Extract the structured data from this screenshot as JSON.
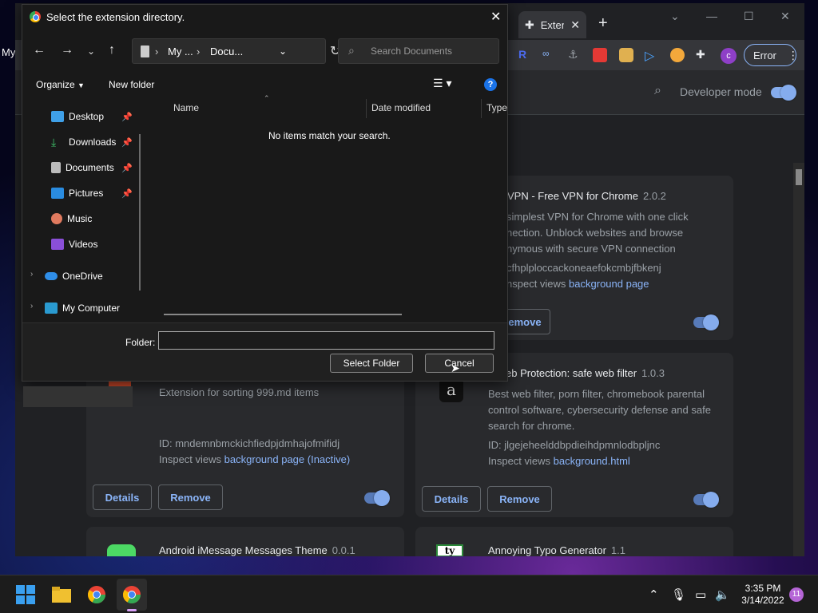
{
  "desktop": {
    "behind_text": "My"
  },
  "chrome": {
    "tab_title": "Extensions",
    "toolbar": {
      "error_label": "Error",
      "avatar_letter": "c"
    },
    "header": {
      "developer_mode_label": "Developer mode",
      "developer_mode_on": true
    },
    "cards": [
      {
        "name": "ckVPN - Free VPN for Chrome",
        "version": "2.0.2",
        "description": "simplest VPN for Chrome with one click nection. Unblock websites and browse nymous with secure VPN connection",
        "id_text": "cfhplploccackoneaefokcmbjfbkenj",
        "inspect_label": "nspect views",
        "inspect_link": "background page",
        "remove_label": "emove",
        "enabled": true
      },
      {
        "name": "",
        "version": "",
        "description": "Extension for sorting 999.md items",
        "id_text": "ID: mndemnbmckichfiedpjdmhajofmifidj",
        "inspect_label": "Inspect views",
        "inspect_link": "background page (Inactive)",
        "details_label": "Details",
        "remove_label": "Remove",
        "enabled": true
      },
      {
        "name": "eb Protection: safe web filter",
        "version": "1.0.3",
        "description": "Best web filter, porn filter, chromebook parental control software, cybersecurity defense and safe search for chrome.",
        "id_text": "ID: jlgejeheelddbpdieihdpmnlodbpljnc",
        "inspect_label": "Inspect views",
        "inspect_link": "background.html",
        "details_label": "Details",
        "remove_label": "Remove",
        "enabled": true
      },
      {
        "name": "Android iMessage Messages Theme",
        "version": "0.0.1"
      },
      {
        "name": "Annoying Typo Generator",
        "version": "1.1"
      }
    ]
  },
  "dialog": {
    "title": "Select the extension directory.",
    "breadcrumb": [
      "My ...",
      "Docu..."
    ],
    "search_placeholder": "Search Documents",
    "organize_label": "Organize",
    "new_folder_label": "New folder",
    "nav_items": [
      {
        "label": "Desktop",
        "pinned": true
      },
      {
        "label": "Downloads",
        "pinned": true
      },
      {
        "label": "Documents",
        "pinned": true
      },
      {
        "label": "Pictures",
        "pinned": true
      },
      {
        "label": "Music",
        "pinned": false
      },
      {
        "label": "Videos",
        "pinned": false
      },
      {
        "label": "OneDrive",
        "pinned": false
      },
      {
        "label": "My Computer",
        "pinned": false
      }
    ],
    "columns": [
      "Name",
      "Date modified",
      "Type"
    ],
    "empty_message": "No items match your search.",
    "folder_label": "Folder:",
    "folder_value": "",
    "select_button": "Select Folder",
    "cancel_button": "Cancel"
  },
  "taskbar": {
    "time": "3:35 PM",
    "date": "3/14/2022",
    "notifications": "11"
  },
  "colors": {
    "accent": "#8ab4f8",
    "chrome_bg": "#202124",
    "card_bg": "#292a2d",
    "dialog_bg": "#191919",
    "help_blue": "#1a73e8"
  }
}
